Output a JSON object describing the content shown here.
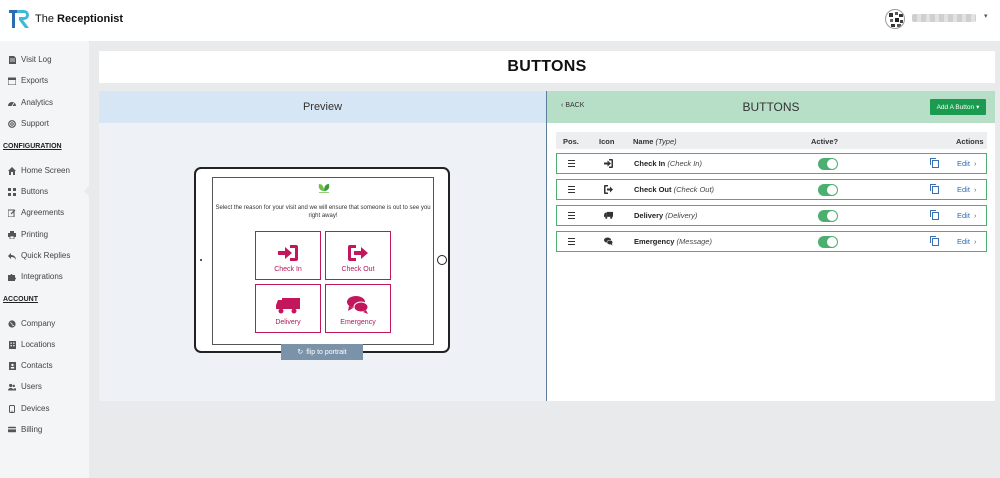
{
  "app": {
    "brand_prefix": "The",
    "brand_name": "Receptionist",
    "user_caret": "▾"
  },
  "sidebar": {
    "items_top": [
      {
        "label": "Visit Log",
        "icon": "file-icon"
      },
      {
        "label": "Exports",
        "icon": "calendar-icon"
      },
      {
        "label": "Analytics",
        "icon": "dashboard-icon"
      },
      {
        "label": "Support",
        "icon": "lifebuoy-icon"
      }
    ],
    "section_config": "CONFIGURATION",
    "items_config": [
      {
        "label": "Home Screen",
        "icon": "home-icon"
      },
      {
        "label": "Buttons",
        "icon": "grid-icon"
      },
      {
        "label": "Agreements",
        "icon": "edit-icon"
      },
      {
        "label": "Printing",
        "icon": "print-icon"
      },
      {
        "label": "Quick Replies",
        "icon": "reply-icon"
      },
      {
        "label": "Integrations",
        "icon": "puzzle-icon"
      }
    ],
    "section_account": "ACCOUNT",
    "items_account": [
      {
        "label": "Company",
        "icon": "globe-icon"
      },
      {
        "label": "Locations",
        "icon": "building-icon"
      },
      {
        "label": "Contacts",
        "icon": "address-book-icon"
      },
      {
        "label": "Users",
        "icon": "users-icon"
      },
      {
        "label": "Devices",
        "icon": "tablet-icon"
      },
      {
        "label": "Billing",
        "icon": "credit-card-icon"
      }
    ]
  },
  "page": {
    "title": "BUTTONS"
  },
  "preview": {
    "header": "Preview",
    "message": "Select the reason for your visit and we will ensure that someone is out to see you right away!",
    "buttons": [
      {
        "label": "Check In",
        "icon": "sign-in-icon"
      },
      {
        "label": "Check Out",
        "icon": "sign-out-icon"
      },
      {
        "label": "Delivery",
        "icon": "truck-icon"
      },
      {
        "label": "Emergency",
        "icon": "comments-icon"
      }
    ],
    "flip_label": "flip to portrait"
  },
  "buttons_panel": {
    "back_label": "BACK",
    "title": "BUTTONS",
    "add_label": "Add A Button",
    "columns": {
      "pos": "Pos.",
      "icon": "Icon",
      "name": "Name",
      "type": "(Type)",
      "active": "Active?",
      "actions": "Actions"
    },
    "rows": [
      {
        "name": "Check In",
        "type": "(Check In)",
        "icon": "sign-in-icon",
        "active": true,
        "edit": "Edit"
      },
      {
        "name": "Check Out",
        "type": "(Check Out)",
        "icon": "sign-out-icon",
        "active": true,
        "edit": "Edit"
      },
      {
        "name": "Delivery",
        "type": "(Delivery)",
        "icon": "truck-icon",
        "active": true,
        "edit": "Edit"
      },
      {
        "name": "Emergency",
        "type": "(Message)",
        "icon": "comments-icon",
        "active": true,
        "edit": "Edit"
      }
    ]
  },
  "colors": {
    "accent_green": "#1a9b4f",
    "tablet_button_magenta": "#c2185b",
    "preview_header": "#d7e6f4",
    "buttons_header": "#b7dfc7",
    "link_blue": "#2d6db5"
  }
}
